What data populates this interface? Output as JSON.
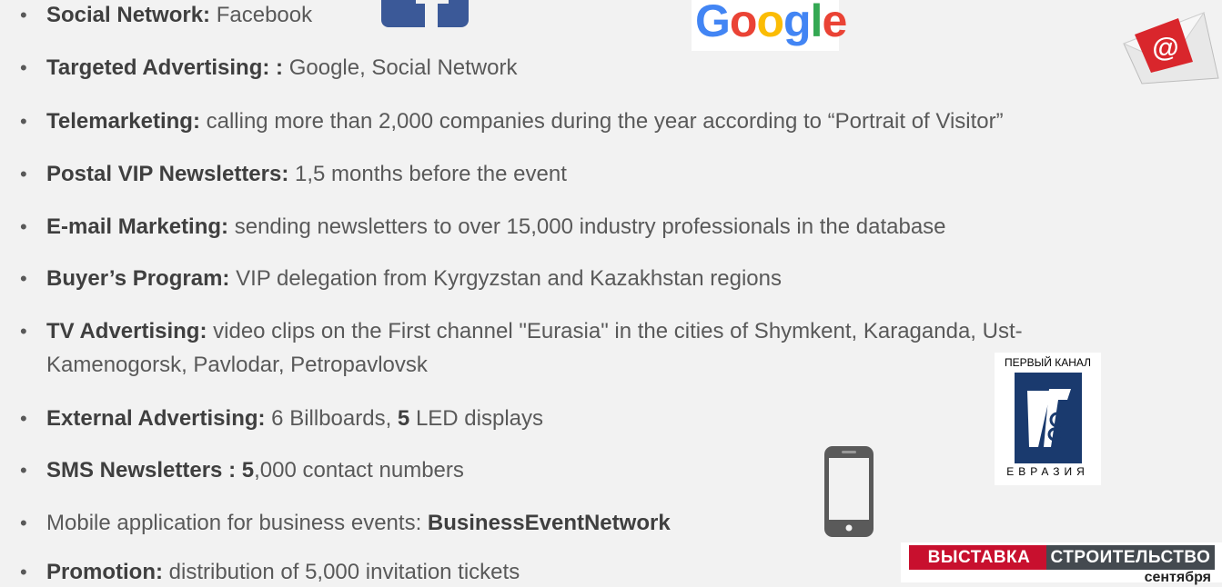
{
  "items": [
    {
      "bold": "Social Network:",
      "text": " Facebook"
    },
    {
      "bold": "Targeted Advertising: :",
      "text": " Google, Social Network"
    },
    {
      "bold": "Telemarketing:",
      "text": " calling more than 2,000 companies during the year according to “Portrait of Visitor”"
    },
    {
      "bold": "Postal VIP Newsletters:",
      "text": " 1,5 months before the event"
    },
    {
      "bold": "E-mail Marketing:",
      "text": " sending newsletters to over 15,000 industry professionals in the database"
    },
    {
      "bold": "Buyer’s Program:",
      "text": " VIP delegation from Kyrgyzstan and Kazakhstan regions"
    },
    {
      "bold": "TV  Advertising:",
      "text": " video clips on the First channel \"Eurasia\" in the cities of Shymkent, Karaganda, Ust-",
      "cont": "Kamenogorsk, Pavlodar, Petropavlovsk"
    },
    {
      "bold": "External Advertising:",
      "text": " 6 Billboards, ",
      "bold2": "5",
      "text2": " LED displays"
    },
    {
      "bold": "SMS Newsletters : 5",
      "text": ",000 contact numbers"
    },
    {
      "text_pre": "Mobile application for business events: ",
      "bold": "BusinessEventNetwork"
    },
    {
      "bold": "Promotion:",
      "text": " distribution of 5,000 invitation tickets"
    }
  ],
  "bullet_glyph": "•",
  "logos": {
    "google": "Google",
    "google_colors": [
      "#4285F4",
      "#EA4335",
      "#FBBC05",
      "#4285F4",
      "#34A853",
      "#EA4335"
    ],
    "facebook_color": "#3b5998",
    "eurasia_top": "ПЕРВЫЙ КАНАЛ",
    "eurasia_bottom": "ЕВРАЗИЯ",
    "eurasia_color": "#1a3a6e",
    "envelope_symbol": "@",
    "envelope_color": "#d9262c"
  },
  "banner": {
    "left": "ВЫСТАВКА",
    "right": "СТРОИТЕЛЬСТВО",
    "date": "сентября"
  },
  "icons": [
    "facebook-icon",
    "google-logo",
    "email-envelope-icon",
    "eurasia-channel-logo",
    "smartphone-icon"
  ]
}
